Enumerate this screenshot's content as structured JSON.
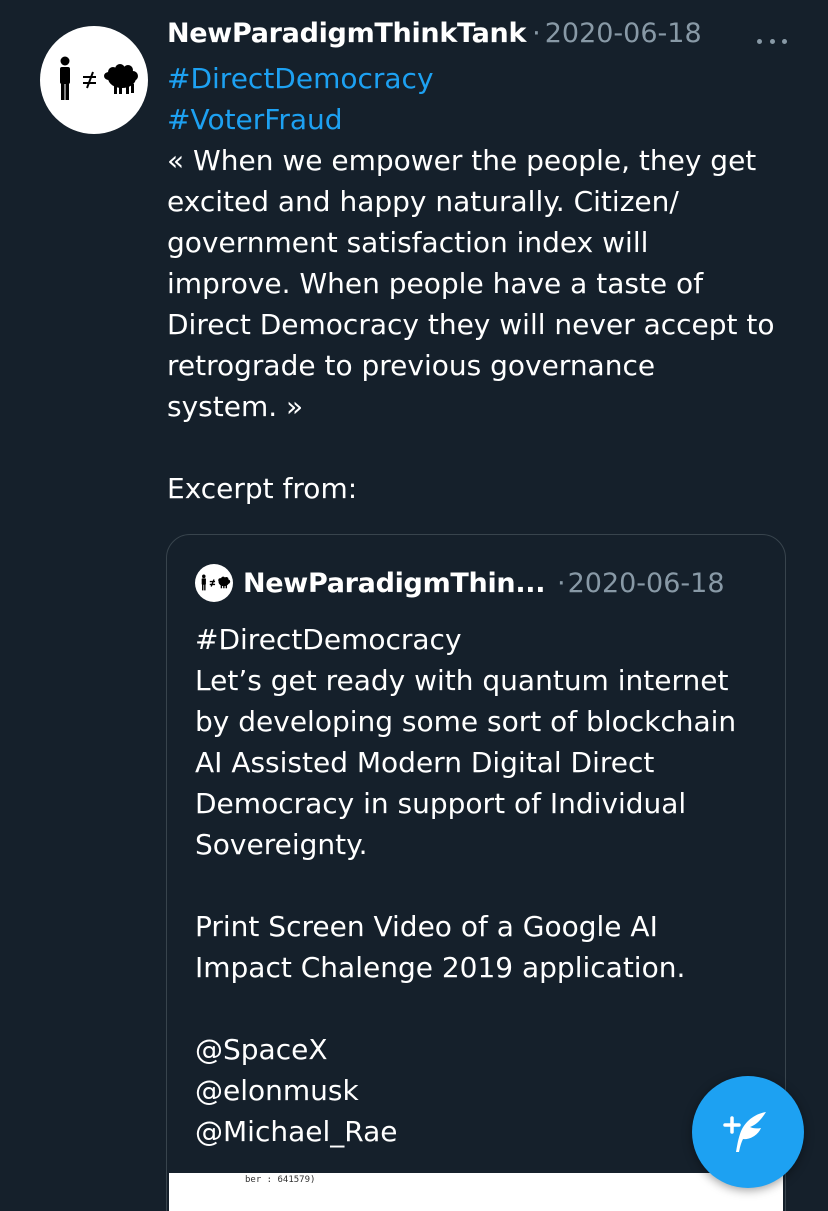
{
  "tweet": {
    "display_name": "NewParadigmThinkTank",
    "separator": "·",
    "date": "2020-06-18",
    "body_lines": [
      {
        "text": "#DirectDemocracy",
        "type": "hashtag"
      },
      {
        "text": "#VoterFraud",
        "type": "hashtag"
      },
      {
        "text": "« When we empower the people, they get",
        "type": "text"
      },
      {
        "text": "excited and happy naturally. Citizen/",
        "type": "text"
      },
      {
        "text": "government satisfaction index will",
        "type": "text"
      },
      {
        "text": "improve. When people have a taste of",
        "type": "text"
      },
      {
        "text": "Direct Democracy they will never accept to",
        "type": "text"
      },
      {
        "text": "retrograde to previous governance",
        "type": "text"
      },
      {
        "text": "system. »",
        "type": "text"
      },
      {
        "text": "",
        "type": "blank"
      },
      {
        "text": "Excerpt from:",
        "type": "text"
      }
    ]
  },
  "quoted_tweet": {
    "display_name": "NewParadigmThin...",
    "separator": "·",
    "date": "2020-06-18",
    "body_lines": [
      "#DirectDemocracy",
      "Let’s get ready with quantum internet",
      "by developing some sort of blockchain",
      "AI Assisted Modern Digital Direct",
      "Democracy in support of Individual",
      "Sovereignty.",
      "",
      "Print Screen Video of a Google AI",
      "Impact Chalenge 2019 application.",
      "",
      "@SpaceX",
      "@elonmusk",
      "@Michael_Rae"
    ],
    "media_snippet": "ber : 641579)"
  },
  "icons": {
    "more": "more-horizontal-icon",
    "compose": "compose-tweet-icon",
    "avatar": "person-not-equal-sheep-logo"
  },
  "colors": {
    "background": "#15202b",
    "link": "#1da1f2",
    "secondary": "#8899a6",
    "border": "#38444d"
  }
}
